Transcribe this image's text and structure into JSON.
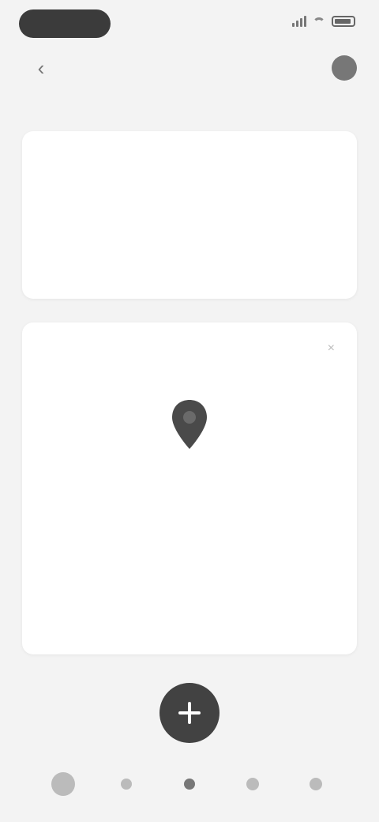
{
  "status": {
    "time": ""
  },
  "header": {
    "title": "",
    "back_glyph": "‹"
  },
  "section": {
    "label": "",
    "link": ""
  },
  "reminder": {
    "title": "",
    "subtitle": "",
    "action": ""
  },
  "empty_state": {
    "close": "×",
    "title": "",
    "subtitle": "",
    "action": ""
  },
  "nav": {
    "items": [
      "home-icon",
      "search-icon",
      "map-icon",
      "list-icon",
      "profile-icon"
    ]
  },
  "colors": {
    "background": "#f3f3f3",
    "card": "#ffffff",
    "fab": "#424242"
  }
}
